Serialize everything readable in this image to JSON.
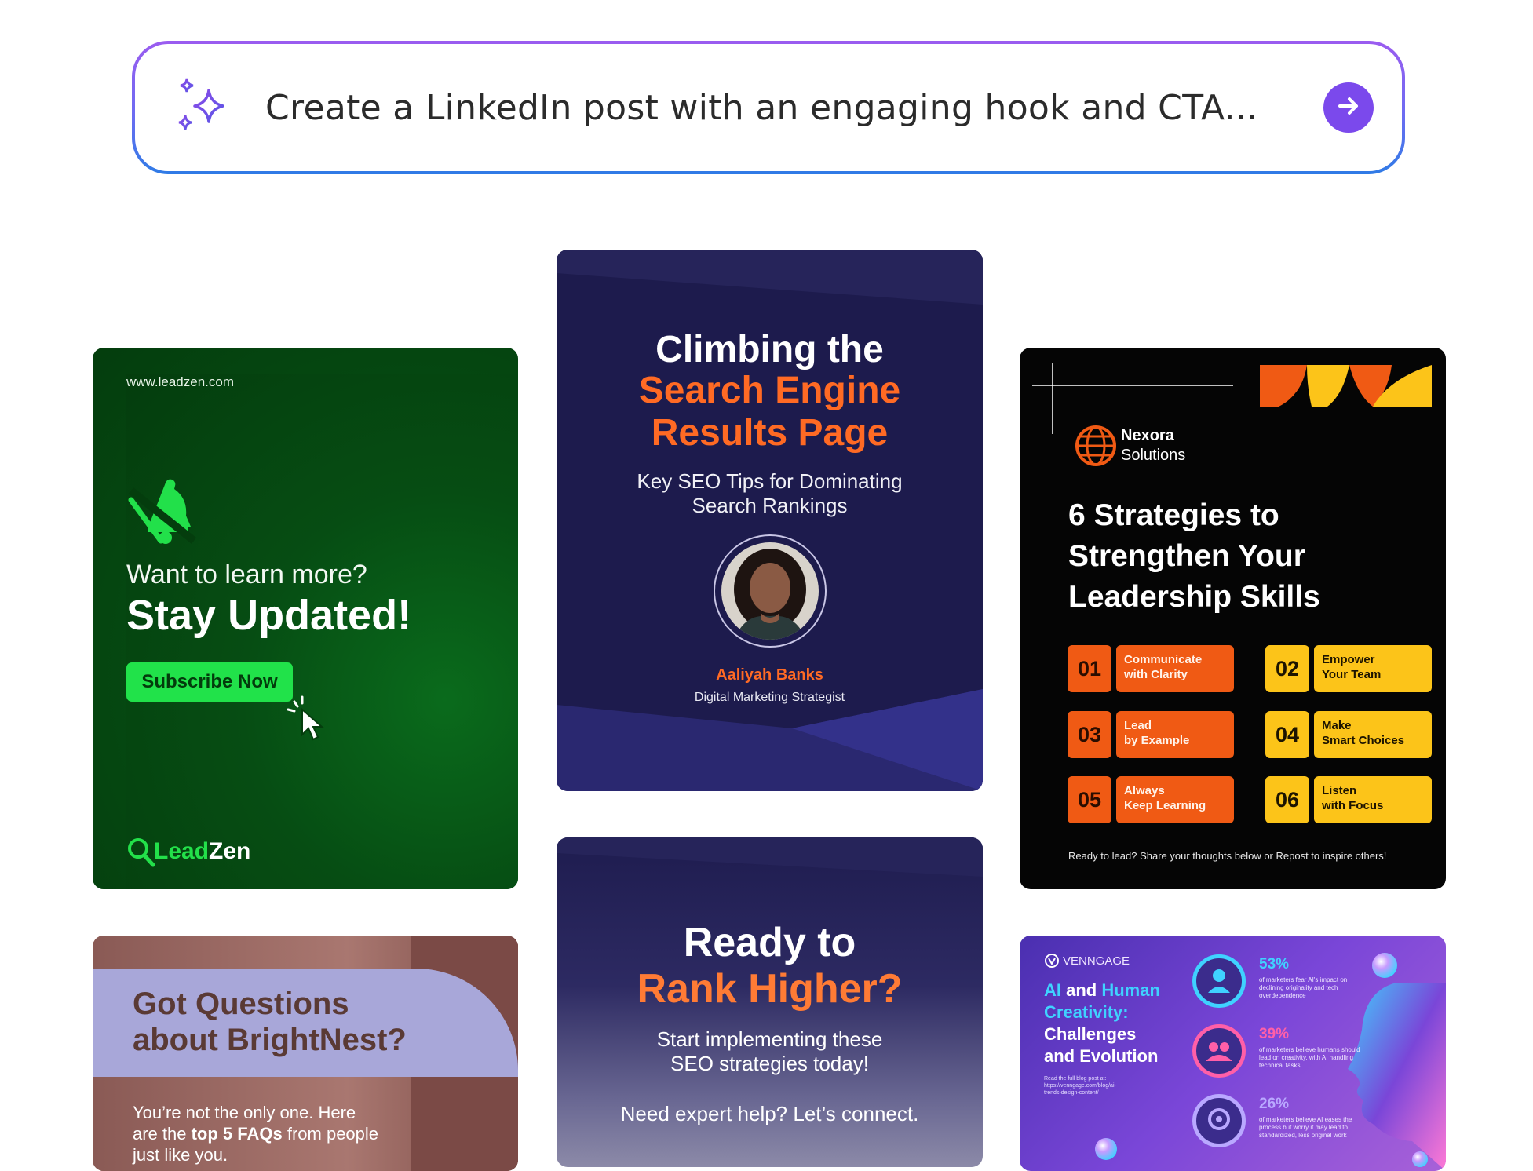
{
  "prompt": {
    "text": "Create a LinkedIn post with an engaging hook and CTA...",
    "icon": "sparkles-icon",
    "send_icon": "arrow-right-icon",
    "accent": "#7b49ec"
  },
  "cards": {
    "leadzen": {
      "url": "www.leadzen.com",
      "question": "Want to learn more?",
      "headline": "Stay Updated!",
      "button": "Subscribe Now",
      "brand_lead": "Lead",
      "brand_zen": "Zen",
      "accent": "#21e24a"
    },
    "seo": {
      "title_line1": "Climbing the",
      "title_line2": "Search Engine",
      "title_line3": "Results Page",
      "subtitle_line1": "Key SEO Tips for Dominating",
      "subtitle_line2": "Search Rankings",
      "name": "Aaliyah Banks",
      "role": "Digital Marketing Strategist",
      "accent": "#ff6a24"
    },
    "nexora": {
      "brand_line1": "Nexora",
      "brand_line2": "Solutions",
      "title_line1": "6 Strategies to",
      "title_line2": "Strengthen Your",
      "title_line3": "Leadership Skills",
      "strategies": [
        {
          "num": "01",
          "line1": "Communicate",
          "line2": "with Clarity"
        },
        {
          "num": "02",
          "line1": "Empower",
          "line2": "Your Team"
        },
        {
          "num": "03",
          "line1": "Lead",
          "line2": "by Example"
        },
        {
          "num": "04",
          "line1": "Make",
          "line2": "Smart Choices"
        },
        {
          "num": "05",
          "line1": "Always",
          "line2": "Keep Learning"
        },
        {
          "num": "06",
          "line1": "Listen",
          "line2": "with Focus"
        }
      ],
      "footer": "Ready to lead? Share your thoughts below or Repost to inspire others!"
    },
    "brightnest": {
      "title_line1": "Got Questions",
      "title_line2": "about BrightNest?",
      "body_line1": "You’re not the only one. Here",
      "body_pre": "are the ",
      "body_bold": "top 5 FAQs",
      "body_post": " from people",
      "body_line3": "just like you."
    },
    "rank": {
      "title_line1": "Ready to",
      "title_line2": "Rank Higher?",
      "sub_line1": "Start implementing these",
      "sub_line2": "SEO strategies today!",
      "cta": "Need expert help? Let’s connect."
    },
    "venngage": {
      "brand": "VENNGAGE",
      "title_ai": "AI",
      "title_and": " and ",
      "title_human": "Human",
      "title_creativity": "Creativity:",
      "title_line3": "Challenges",
      "title_line4": "and Evolution",
      "read": "Read the full blog post at: https://venngage.com/blog/ai-trends-design-content/",
      "stats": [
        {
          "pct": "53%",
          "desc": "of marketers fear AI's impact on declining originality and tech overdependence",
          "color": "#3fd2ff"
        },
        {
          "pct": "39%",
          "desc": "of marketers believe humans should lead on creativity, with AI handling technical tasks",
          "color": "#ff5fa8"
        },
        {
          "pct": "26%",
          "desc": "of marketers believe AI eases the process but worry it may lead to standardized, less original work",
          "color": "#b9a8ff"
        }
      ]
    }
  }
}
